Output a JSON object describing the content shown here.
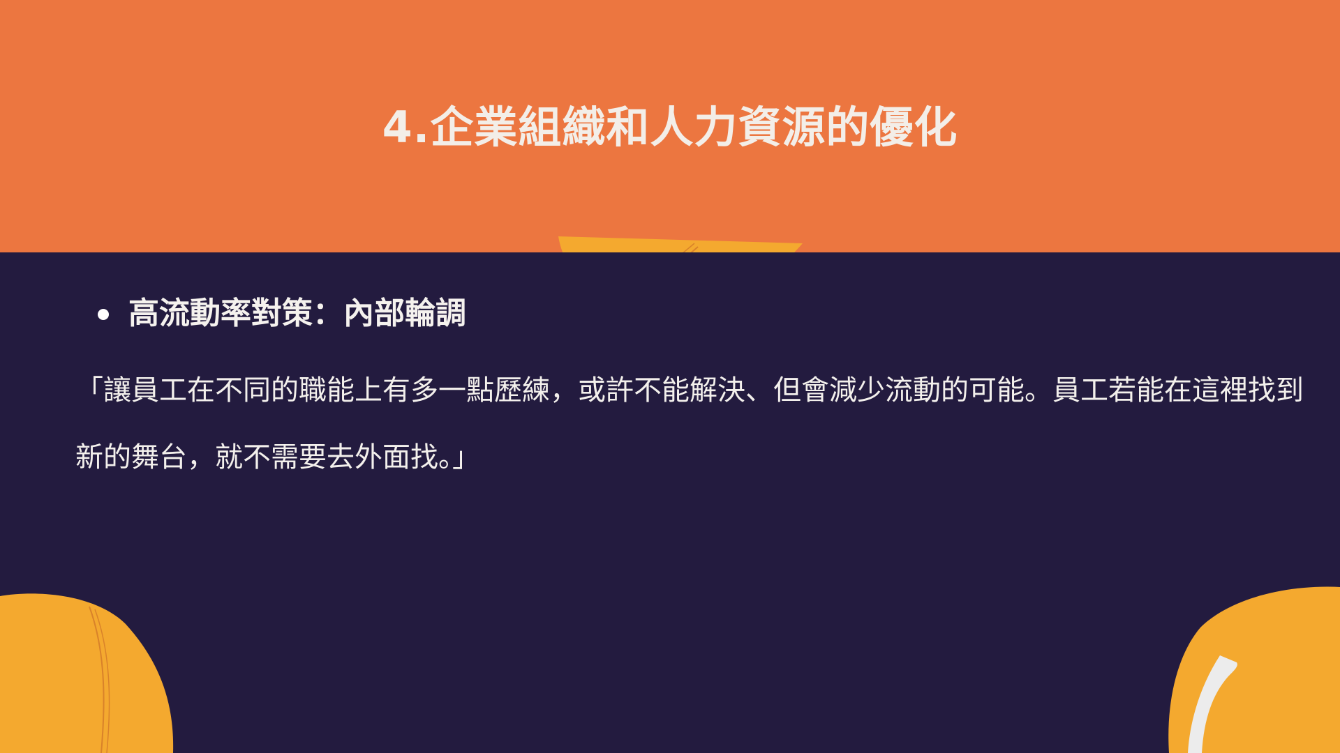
{
  "slide": {
    "title": "4.企業組織和人力資源的優化",
    "bullet": "高流動率對策：內部輪調",
    "quote": "「讓員工在不同的職能上有多一點歷練，或許不能解決、但會減少流動的可能。員工若能在這裡找到新的舞台，就不需要去外面找。」"
  },
  "colors": {
    "header": "#ec7640",
    "background": "#231b3f",
    "accent_circle": "#f4a92f",
    "text": "#f3f0ec"
  }
}
